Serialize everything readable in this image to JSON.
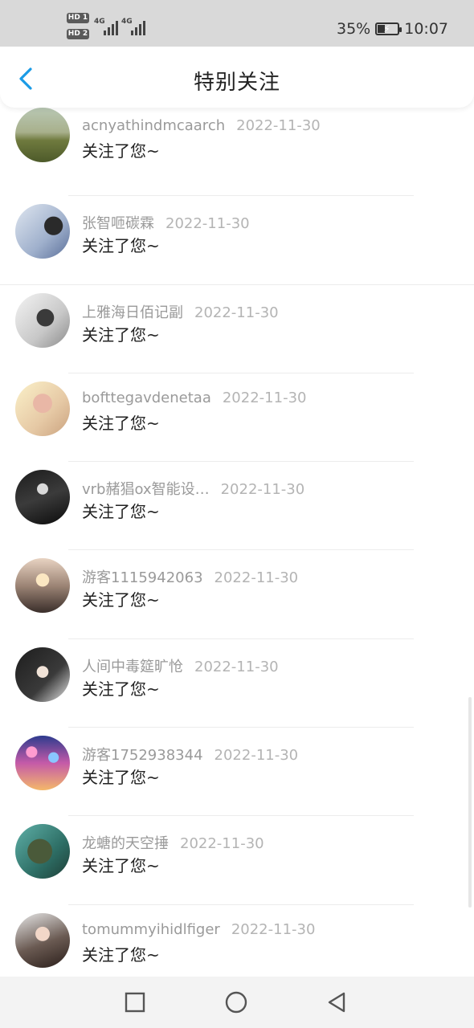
{
  "status_bar": {
    "sim1": "HD 1",
    "sim2": "HD 2",
    "network1": "4G",
    "network2": "4G",
    "battery": "35%",
    "battery_level": 35,
    "time": "10:07"
  },
  "header": {
    "title": "特别关注",
    "back_icon": "chevron-left-icon"
  },
  "accent_color": "#1a9be6",
  "items": [
    {
      "name": "acnyathindmcaarch",
      "date": "2022-11-30",
      "message": "关注了您~"
    },
    {
      "name": "张智咂碳霖",
      "date": "2022-11-30",
      "message": "关注了您~"
    },
    {
      "name": "上雅海日佰记副",
      "date": "2022-11-30",
      "message": "关注了您~"
    },
    {
      "name": "bofttegavdenetaa",
      "date": "2022-11-30",
      "message": "关注了您~"
    },
    {
      "name": "vrb赭猖ox智能设…",
      "date": "2022-11-30",
      "message": "关注了您~"
    },
    {
      "name": "游客1115942063",
      "date": "2022-11-30",
      "message": "关注了您~"
    },
    {
      "name": "人间中毒筵旷怆",
      "date": "2022-11-30",
      "message": "关注了您~"
    },
    {
      "name": "游客1752938344",
      "date": "2022-11-30",
      "message": "关注了您~"
    },
    {
      "name": "龙螗的天空捶",
      "date": "2022-11-30",
      "message": "关注了您~"
    },
    {
      "name": "tomummyihidlfiger",
      "date": "2022-11-30",
      "message": "关注了您~"
    }
  ],
  "nav": {
    "recent": "square-icon",
    "home": "circle-icon",
    "back": "triangle-back-icon"
  }
}
